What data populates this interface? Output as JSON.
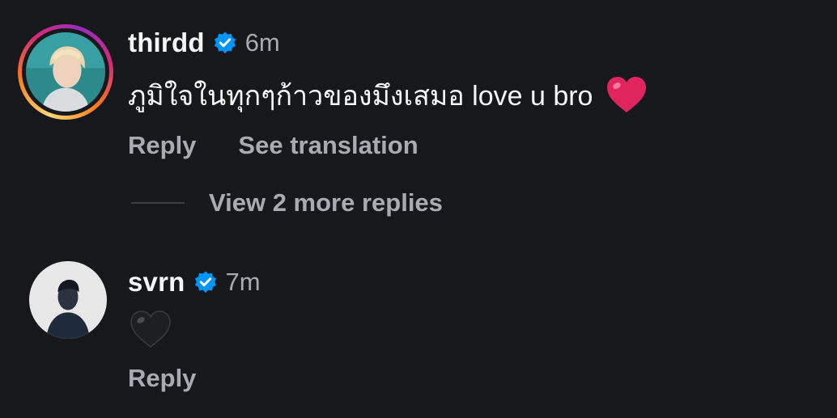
{
  "comments": [
    {
      "username": "thirdd",
      "time": "6m",
      "text": "ภูมิใจในทุกๆก้าวของมึงเสมอ love u bro",
      "emoji": "❤️",
      "reply_label": "Reply",
      "translation_label": "See translation",
      "view_more_label": "View 2 more replies",
      "verified_icon": "verified-badge-icon",
      "has_story_ring": true
    },
    {
      "username": "svrn",
      "time": "7m",
      "emoji": "🖤",
      "reply_label": "Reply",
      "verified_icon": "verified-badge-icon",
      "has_story_ring": false
    }
  ],
  "colors": {
    "background": "#16181c",
    "primary_text": "#f5f5f5",
    "secondary_text": "#a8abb2",
    "verified_blue": "#0095f6",
    "heart_red": "#e0245e"
  }
}
